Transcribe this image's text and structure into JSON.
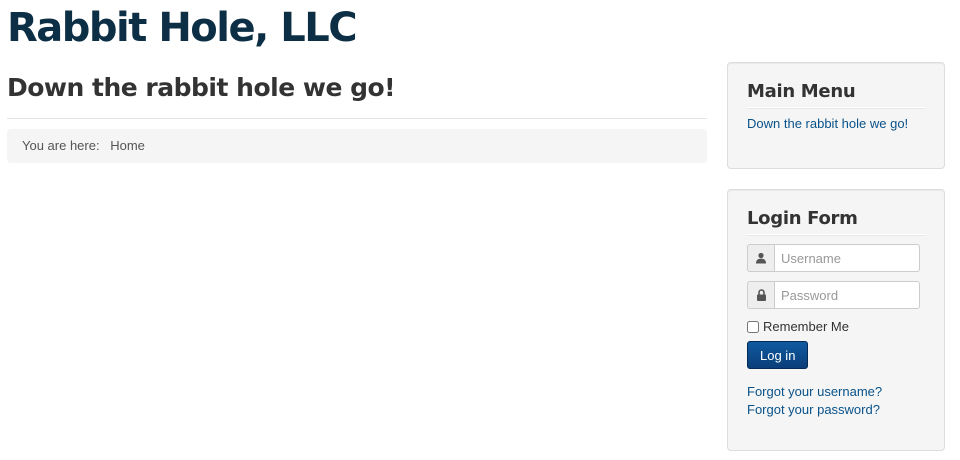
{
  "site": {
    "title": "Rabbit Hole, LLC"
  },
  "main": {
    "heading": "Down the rabbit hole we go!",
    "breadcrumb": {
      "label": "You are here:",
      "home": "Home"
    }
  },
  "main_menu": {
    "title": "Main Menu",
    "items": [
      {
        "label": "Down the rabbit hole we go!"
      }
    ]
  },
  "login_form": {
    "title": "Login Form",
    "username": {
      "placeholder": "Username",
      "value": "",
      "icon": "user-icon"
    },
    "password": {
      "placeholder": "Password",
      "value": "",
      "icon": "lock-icon"
    },
    "remember_label": "Remember Me",
    "remember_checked": false,
    "submit_label": "Log in",
    "forgot_username": "Forgot your username?",
    "forgot_password": "Forgot your password?"
  },
  "colors": {
    "title": "#0d2f45",
    "link": "#08528a",
    "button": "#0a3d79",
    "well_background": "#f5f5f5"
  }
}
